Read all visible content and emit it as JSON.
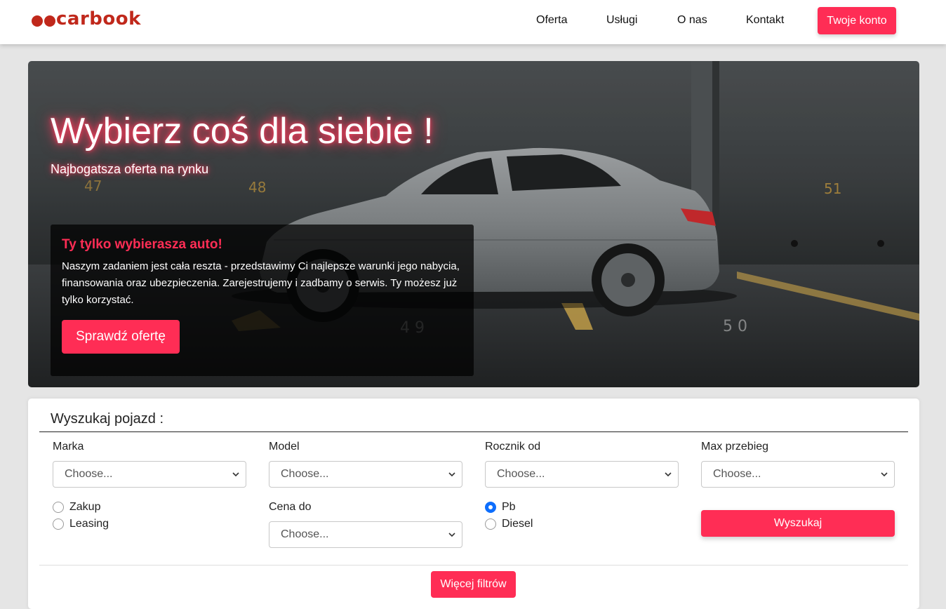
{
  "brand": {
    "name": "carbook",
    "color": "#c0281b",
    "accent": "#ff2d55"
  },
  "nav": {
    "links": [
      "Oferta",
      "Usługi",
      "O nas",
      "Kontakt"
    ],
    "account_button": "Twoje konto"
  },
  "hero": {
    "title": "Wybierz coś dla siebie !",
    "subtitle": "Najbogatsza oferta na rynku",
    "parking_numbers": [
      "47",
      "48",
      "49",
      "51",
      "4 9",
      "5 0"
    ],
    "info_box": {
      "heading": "Ty tylko wybierasza auto!",
      "text": "Naszym zadaniem jest cała reszta - przedstawimy Ci najlepsze warunki jego nabycia, finansowania oraz ubezpieczenia. Zarejestrujemy i zadbamy o serwis. Ty możesz już tylko korzystać.",
      "button": "Sprawdź ofertę"
    }
  },
  "search": {
    "title": "Wyszukaj pojazd :",
    "fields": [
      {
        "label": "Marka",
        "value": "Choose..."
      },
      {
        "label": "Model",
        "value": "Choose..."
      },
      {
        "label": "Rocznik od",
        "value": "Choose..."
      },
      {
        "label": "Max przebieg",
        "value": "Choose..."
      },
      {
        "label": "Cena do",
        "value": "Choose..."
      }
    ],
    "purchase_options": [
      {
        "label": "Zakup",
        "checked": false
      },
      {
        "label": "Leasing",
        "checked": false
      }
    ],
    "fuel_options": [
      {
        "label": "Pb",
        "checked": true
      },
      {
        "label": "Diesel",
        "checked": false
      }
    ],
    "search_button": "Wyszukaj",
    "more_filters_button": "Więcej filtrów"
  }
}
